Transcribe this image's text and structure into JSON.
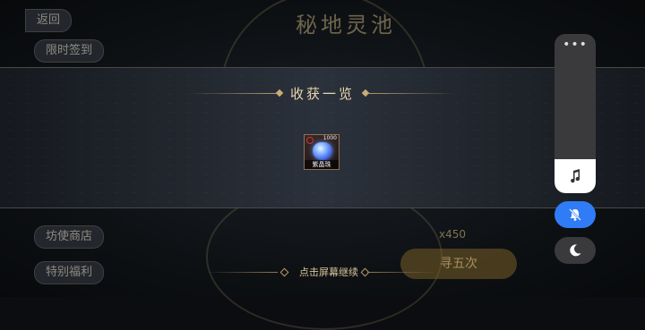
{
  "background": {
    "title": "秘地灵池",
    "top_left_back": "返回",
    "top_left_btn": "限时签到",
    "left_btn_1": "坊使商店",
    "left_btn_2": "特别福利",
    "count": "x450",
    "big_btn": "寻五次"
  },
  "banner": {
    "title": "收获一览"
  },
  "reward": {
    "name": "紫晶珠",
    "quantity": "1000",
    "icon": "blue-gem-icon"
  },
  "hint": {
    "text": "点击屏幕继续"
  },
  "system_panel": {
    "more": "•••",
    "icons": [
      "music-note-icon",
      "bell-mute-icon",
      "moon-icon"
    ],
    "accent": "#2f7cf6"
  }
}
